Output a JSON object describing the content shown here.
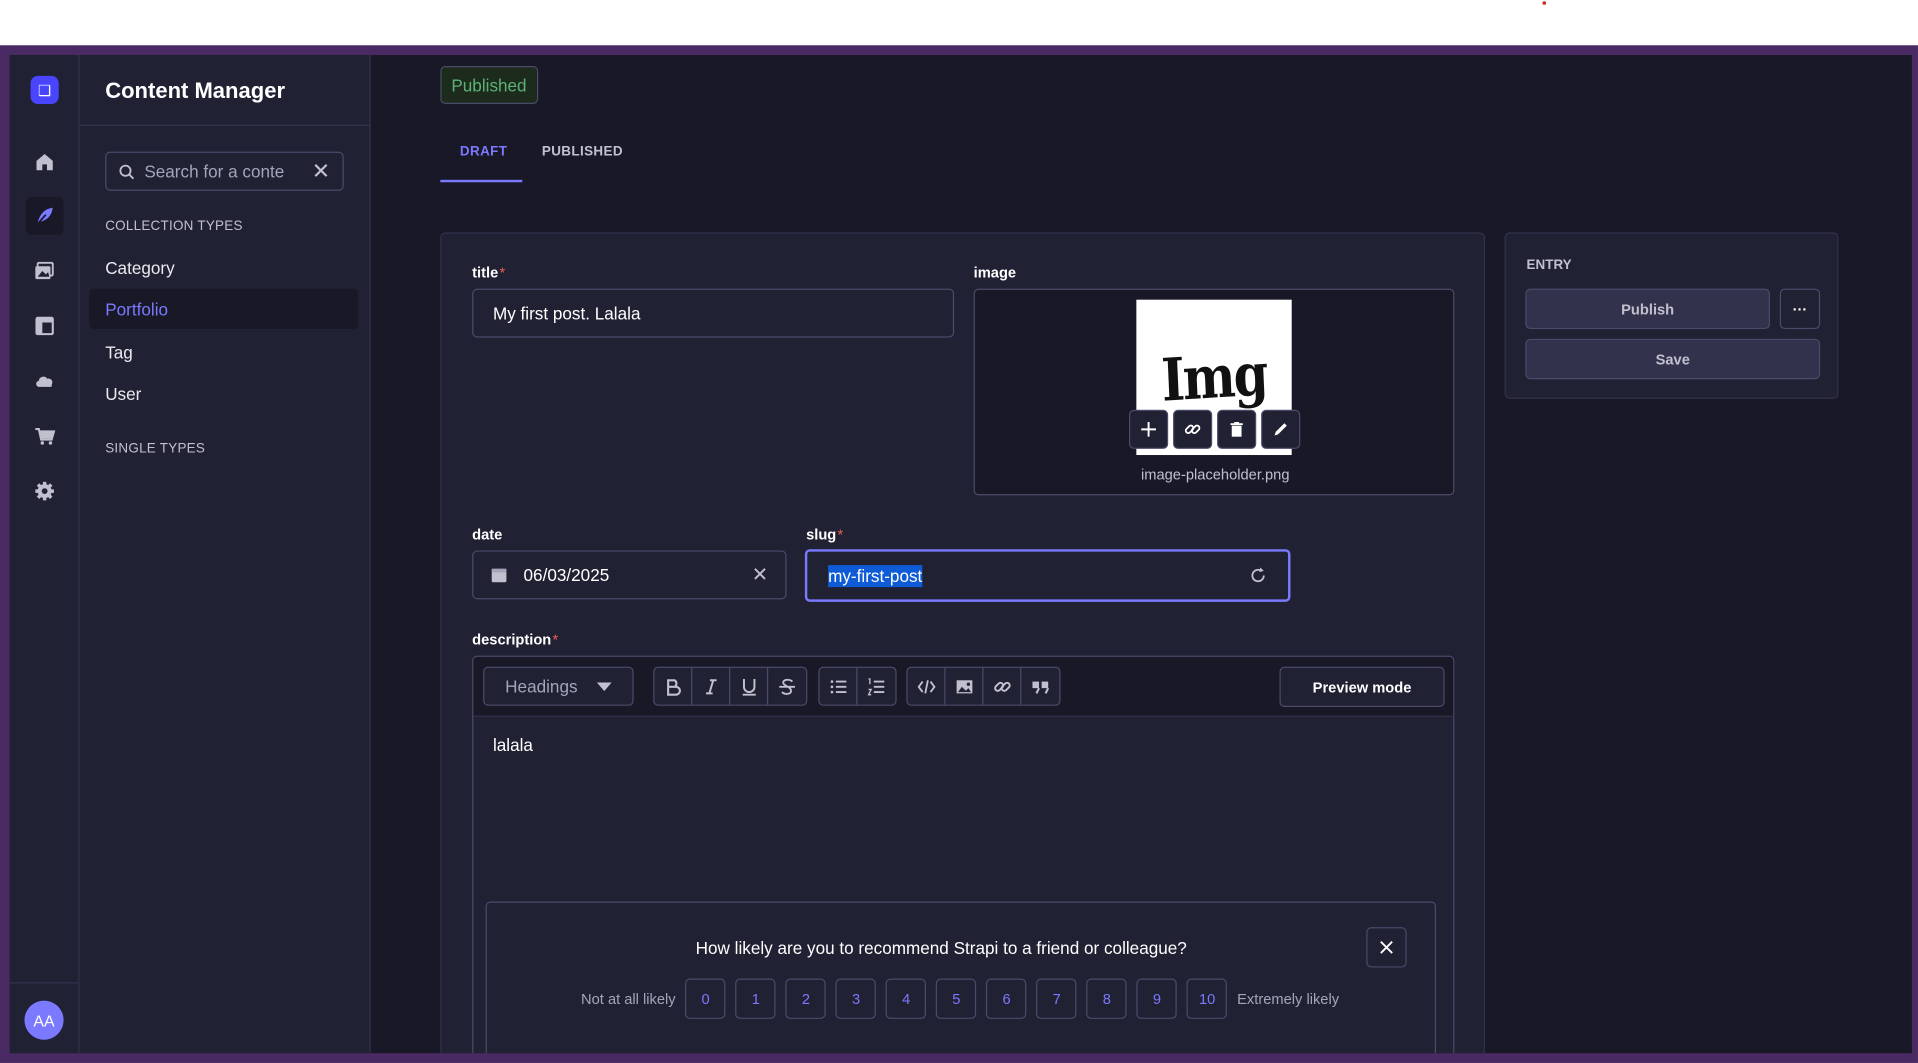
{
  "app": {
    "title": "Content Manager",
    "avatar_initials": "AA",
    "logo_glyph": "❑"
  },
  "sidebar": {
    "search_placeholder": "Search for a conte",
    "collection_types_label": "COLLECTION TYPES",
    "single_types_label": "SINGLE TYPES",
    "items": [
      {
        "label": "Category"
      },
      {
        "label": "Portfolio",
        "active": true
      },
      {
        "label": "Tag"
      },
      {
        "label": "User"
      }
    ]
  },
  "rail_icons": [
    "home-icon",
    "feather-icon",
    "media-library-icon",
    "layout-icon",
    "cloud-icon",
    "cart-icon",
    "gear-icon"
  ],
  "status_badge": "Published",
  "tabs": [
    {
      "label": "DRAFT"
    },
    {
      "label": "PUBLISHED"
    }
  ],
  "form": {
    "title": {
      "label": "title",
      "required": "*",
      "value": "My first post. Lalala"
    },
    "image": {
      "label": "image",
      "thumb_text": "Img",
      "filename": "image-placeholder.png"
    },
    "date": {
      "label": "date",
      "value": "06/03/2025"
    },
    "slug": {
      "label": "slug",
      "required": "*",
      "value": "my-first-post"
    },
    "description": {
      "label": "description",
      "required": "*",
      "heading_select": "Headings",
      "preview_mode": "Preview mode",
      "content": "lalala"
    }
  },
  "entry": {
    "label": "ENTRY",
    "publish": "Publish",
    "more": "···",
    "save": "Save"
  },
  "nps": {
    "question": "How likely are you to recommend Strapi to a friend or colleague?",
    "low_label": "Not at all likely",
    "high_label": "Extremely likely",
    "scores": [
      "0",
      "1",
      "2",
      "3",
      "4",
      "5",
      "6",
      "7",
      "8",
      "9",
      "10"
    ]
  },
  "colors": {
    "accent": "#7b79ff",
    "primary": "#4945ff",
    "background": "#181826",
    "panel": "#212134",
    "success": "#5cb176",
    "danger": "#ee5e52"
  }
}
